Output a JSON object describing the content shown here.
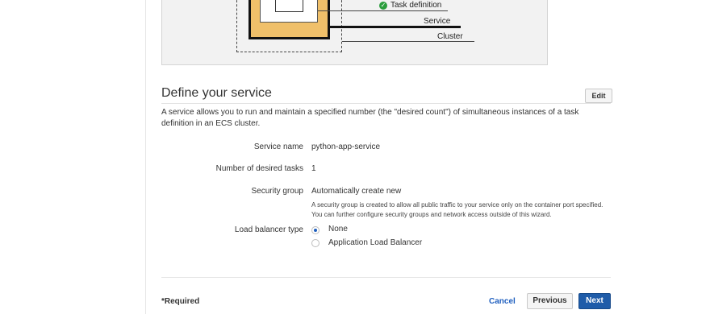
{
  "diagram": {
    "labels": {
      "task_definition": "Task definition",
      "service": "Service",
      "cluster": "Cluster"
    }
  },
  "section": {
    "title": "Define your service",
    "edit_label": "Edit",
    "description": "A service allows you to run and maintain a specified number (the \"desired count\") of simultaneous instances of a task definition in an ECS cluster."
  },
  "fields": {
    "service_name": {
      "label": "Service name",
      "value": "python-app-service"
    },
    "desired_tasks": {
      "label": "Number of desired tasks",
      "value": "1"
    },
    "security_group": {
      "label": "Security group",
      "value": "Automatically create new",
      "help_line1": "A security group is created to allow all public traffic to your service only on the container port specified.",
      "help_line2": "You can further configure security groups and network access outside of this wizard."
    },
    "load_balancer": {
      "label": "Load balancer type",
      "options": [
        {
          "label": "None",
          "selected": true
        },
        {
          "label": "Application Load Balancer",
          "selected": false
        }
      ]
    }
  },
  "footer": {
    "required_note": "*Required",
    "cancel_label": "Cancel",
    "previous_label": "Previous",
    "next_label": "Next"
  },
  "colors": {
    "primary": "#1f5ca9",
    "service_fill": "#f0c06a",
    "check_green": "#2a9d3c"
  }
}
